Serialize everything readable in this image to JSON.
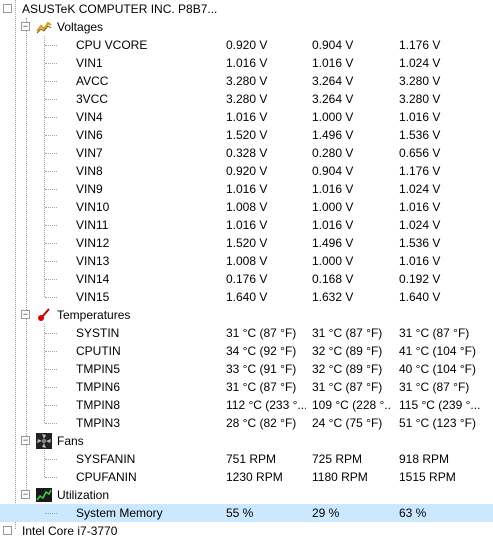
{
  "device": {
    "title": "ASUSTeK COMPUTER INC. P8B7..."
  },
  "groups": [
    {
      "name": "Voltages",
      "icon": "voltage-icon",
      "rows": [
        {
          "label": "CPU VCORE",
          "value": "0.920 V",
          "min": "0.904 V",
          "max": "1.176 V"
        },
        {
          "label": "VIN1",
          "value": "1.016 V",
          "min": "1.016 V",
          "max": "1.024 V"
        },
        {
          "label": "AVCC",
          "value": "3.280 V",
          "min": "3.264 V",
          "max": "3.280 V"
        },
        {
          "label": "3VCC",
          "value": "3.280 V",
          "min": "3.264 V",
          "max": "3.280 V"
        },
        {
          "label": "VIN4",
          "value": "1.016 V",
          "min": "1.000 V",
          "max": "1.016 V"
        },
        {
          "label": "VIN6",
          "value": "1.520 V",
          "min": "1.496 V",
          "max": "1.536 V"
        },
        {
          "label": "VIN7",
          "value": "0.328 V",
          "min": "0.280 V",
          "max": "0.656 V"
        },
        {
          "label": "VIN8",
          "value": "0.920 V",
          "min": "0.904 V",
          "max": "1.176 V"
        },
        {
          "label": "VIN9",
          "value": "1.016 V",
          "min": "1.016 V",
          "max": "1.024 V"
        },
        {
          "label": "VIN10",
          "value": "1.008 V",
          "min": "1.000 V",
          "max": "1.016 V"
        },
        {
          "label": "VIN11",
          "value": "1.016 V",
          "min": "1.016 V",
          "max": "1.024 V"
        },
        {
          "label": "VIN12",
          "value": "1.520 V",
          "min": "1.496 V",
          "max": "1.536 V"
        },
        {
          "label": "VIN13",
          "value": "1.008 V",
          "min": "1.000 V",
          "max": "1.016 V"
        },
        {
          "label": "VIN14",
          "value": "0.176 V",
          "min": "0.168 V",
          "max": "0.192 V"
        },
        {
          "label": "VIN15",
          "value": "1.640 V",
          "min": "1.632 V",
          "max": "1.640 V"
        }
      ]
    },
    {
      "name": "Temperatures",
      "icon": "thermometer-icon",
      "rows": [
        {
          "label": "SYSTIN",
          "value": "31 °C  (87 °F)",
          "min": "31 °C  (87 °F)",
          "max": "31 °C  (87 °F)"
        },
        {
          "label": "CPUTIN",
          "value": "34 °C  (92 °F)",
          "min": "32 °C  (89 °F)",
          "max": "41 °C  (104 °F)"
        },
        {
          "label": "TMPIN5",
          "value": "33 °C  (91 °F)",
          "min": "32 °C  (89 °F)",
          "max": "40 °C  (104 °F)"
        },
        {
          "label": "TMPIN6",
          "value": "31 °C  (87 °F)",
          "min": "31 °C  (87 °F)",
          "max": "31 °C  (87 °F)"
        },
        {
          "label": "TMPIN8",
          "value": "112 °C  (233 °...",
          "min": "109 °C  (228 °...",
          "max": "115 °C  (239 °..."
        },
        {
          "label": "TMPIN3",
          "value": "28 °C  (82 °F)",
          "min": "24 °C  (75 °F)",
          "max": "51 °C  (123 °F)"
        }
      ]
    },
    {
      "name": "Fans",
      "icon": "fan-icon",
      "rows": [
        {
          "label": "SYSFANIN",
          "value": "751 RPM",
          "min": "725 RPM",
          "max": "918 RPM"
        },
        {
          "label": "CPUFANIN",
          "value": "1230 RPM",
          "min": "1180 RPM",
          "max": "1515 RPM"
        }
      ]
    },
    {
      "name": "Utilization",
      "icon": "utilization-icon",
      "rows": [
        {
          "label": "System Memory",
          "value": "55 %",
          "min": "29 %",
          "max": "63 %"
        }
      ]
    }
  ],
  "next_device": {
    "title": "Intel Core i7-3770"
  },
  "colors": {
    "selection": "#cce8ff",
    "tree_line": "#a0a0a0"
  }
}
